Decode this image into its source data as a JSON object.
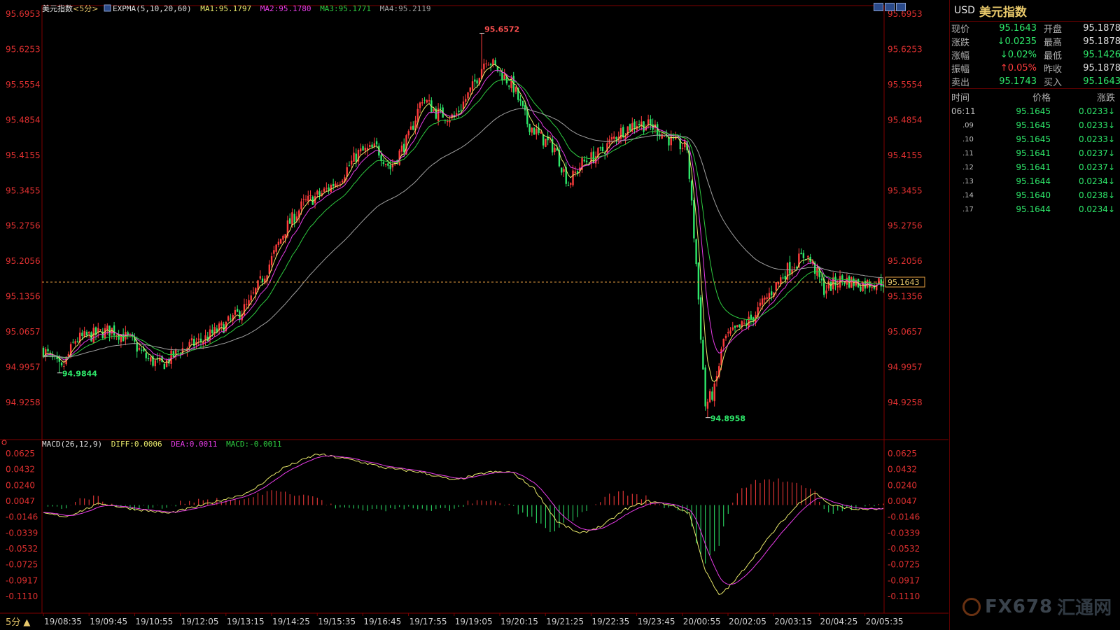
{
  "main_legend": {
    "symbol": "美元指数",
    "period": "<5分>",
    "indicator": "EXPMA(5,10,20,60)",
    "ma1": "MA1:95.1797",
    "ma2": "MA2:95.1780",
    "ma3": "MA3:95.1771",
    "ma4": "MA4:95.2119"
  },
  "macd_legend": {
    "indicator": "MACD(26,12,9)",
    "diff": "DIFF:0.0006",
    "dea": "DEA:0.0011",
    "macd": "MACD:-0.0011"
  },
  "price_axis_labels": [
    "95.6953",
    "95.6253",
    "95.5554",
    "95.4854",
    "95.4155",
    "95.3455",
    "95.2756",
    "95.2056",
    "95.1356",
    "95.0657",
    "94.9957",
    "94.9258"
  ],
  "macd_axis_labels": [
    "0.0625",
    "0.0432",
    "0.0240",
    "0.0047",
    "-0.0146",
    "-0.0339",
    "-0.0532",
    "-0.0725",
    "-0.0917",
    "-0.1110"
  ],
  "time_labels": [
    "19/08:35",
    "19/09:45",
    "19/10:55",
    "19/12:05",
    "19/13:15",
    "19/14:25",
    "19/15:35",
    "19/16:45",
    "19/17:55",
    "19/19:05",
    "19/20:15",
    "19/21:25",
    "19/22:35",
    "19/23:45",
    "20/00:55",
    "20/02:05",
    "20/03:15",
    "20/04:25",
    "20/05:35"
  ],
  "annotations": {
    "high_label": "95.6572",
    "low_label_1": "94.9844",
    "low_label_2": "94.8958",
    "current_price_tag": "95.1643"
  },
  "period_selector": "5分 ▲",
  "colors": {
    "up": "#ff3c3c",
    "down": "#2ee86a",
    "ma1": "#e8e86a",
    "ma2": "#e83ce8",
    "ma3": "#2ecc40",
    "ma4": "#a0a0a0",
    "axis_text": "#e03030",
    "grid_border": "#800000"
  },
  "panel": {
    "code": "USD",
    "name": "美元指数",
    "quotes": [
      {
        "l1": "现价",
        "v1": "95.1643",
        "c1": "#2ee86a",
        "l2": "开盘",
        "v2": "95.1878",
        "c2": "#e0e0e0"
      },
      {
        "l1": "涨跌",
        "v1": "↓0.0235",
        "c1": "#2ee86a",
        "l2": "最高",
        "v2": "95.1878",
        "c2": "#e0e0e0"
      },
      {
        "l1": "涨幅",
        "v1": "↓0.02%",
        "c1": "#2ee86a",
        "l2": "最低",
        "v2": "95.1426",
        "c2": "#2ee86a"
      },
      {
        "l1": "振幅",
        "v1": "↑0.05%",
        "c1": "#ff3c3c",
        "l2": "昨收",
        "v2": "95.1878",
        "c2": "#e0e0e0"
      },
      {
        "l1": "卖出",
        "v1": "95.1743",
        "c1": "#2ee86a",
        "l2": "买入",
        "v2": "95.1643",
        "c2": "#2ee86a"
      }
    ],
    "ticks_header": {
      "time": "时间",
      "price": "价格",
      "change": "涨跌"
    },
    "ticks": [
      {
        "t": "06:11",
        "p": "95.1645",
        "c": "0.0233↓"
      },
      {
        "t": ".09",
        "p": "95.1645",
        "c": "0.0233↓"
      },
      {
        "t": ".10",
        "p": "95.1645",
        "c": "0.0233↓"
      },
      {
        "t": ".11",
        "p": "95.1641",
        "c": "0.0237↓"
      },
      {
        "t": ".12",
        "p": "95.1641",
        "c": "0.0237↓"
      },
      {
        "t": ".13",
        "p": "95.1644",
        "c": "0.0234↓"
      },
      {
        "t": ".14",
        "p": "95.1640",
        "c": "0.0238↓"
      },
      {
        "t": ".17",
        "p": "95.1644",
        "c": "0.0234↓"
      }
    ]
  },
  "watermark": {
    "brand": "FX678",
    "cn": "汇通网"
  },
  "chart_data": {
    "type": "candlestick",
    "price_range": [
      94.8958,
      95.6953
    ],
    "current_price": 95.1643,
    "anchors": [
      [
        0,
        95.03
      ],
      [
        8,
        94.99
      ],
      [
        14,
        95.05
      ],
      [
        22,
        95.06
      ],
      [
        30,
        95.07
      ],
      [
        38,
        95.05
      ],
      [
        46,
        95.01
      ],
      [
        52,
        95.0
      ],
      [
        60,
        95.03
      ],
      [
        70,
        95.05
      ],
      [
        80,
        95.08
      ],
      [
        90,
        95.12
      ],
      [
        98,
        95.19
      ],
      [
        106,
        95.27
      ],
      [
        114,
        95.32
      ],
      [
        122,
        95.34
      ],
      [
        130,
        95.37
      ],
      [
        138,
        95.42
      ],
      [
        146,
        95.43
      ],
      [
        152,
        95.39
      ],
      [
        160,
        95.45
      ],
      [
        166,
        95.53
      ],
      [
        172,
        95.5
      ],
      [
        180,
        95.49
      ],
      [
        188,
        95.55
      ],
      [
        194,
        95.61
      ],
      [
        200,
        95.58
      ],
      [
        206,
        95.55
      ],
      [
        212,
        95.48
      ],
      [
        218,
        95.45
      ],
      [
        224,
        95.43
      ],
      [
        230,
        95.36
      ],
      [
        236,
        95.4
      ],
      [
        244,
        95.42
      ],
      [
        252,
        95.46
      ],
      [
        260,
        95.48
      ],
      [
        268,
        95.47
      ],
      [
        276,
        95.44
      ],
      [
        282,
        95.43
      ],
      [
        286,
        95.2
      ],
      [
        290,
        94.92
      ],
      [
        294,
        94.95
      ],
      [
        298,
        95.05
      ],
      [
        304,
        95.07
      ],
      [
        310,
        95.09
      ],
      [
        318,
        95.14
      ],
      [
        326,
        95.19
      ],
      [
        334,
        95.22
      ],
      [
        338,
        95.19
      ],
      [
        342,
        95.15
      ],
      [
        350,
        95.17
      ],
      [
        358,
        95.16
      ],
      [
        368,
        95.165
      ]
    ],
    "macd_range": [
      -0.111,
      0.0625
    ],
    "macd_anchors": [
      [
        0,
        -0.01
      ],
      [
        10,
        -0.014
      ],
      [
        25,
        0.002
      ],
      [
        40,
        -0.005
      ],
      [
        55,
        -0.01
      ],
      [
        70,
        0.0
      ],
      [
        90,
        0.015
      ],
      [
        105,
        0.045
      ],
      [
        120,
        0.062
      ],
      [
        135,
        0.055
      ],
      [
        150,
        0.045
      ],
      [
        165,
        0.04
      ],
      [
        180,
        0.03
      ],
      [
        195,
        0.04
      ],
      [
        205,
        0.04
      ],
      [
        215,
        0.02
      ],
      [
        225,
        -0.02
      ],
      [
        235,
        -0.035
      ],
      [
        245,
        -0.025
      ],
      [
        255,
        -0.005
      ],
      [
        265,
        0.005
      ],
      [
        275,
        0.0
      ],
      [
        283,
        -0.01
      ],
      [
        290,
        -0.08
      ],
      [
        296,
        -0.11
      ],
      [
        302,
        -0.095
      ],
      [
        312,
        -0.06
      ],
      [
        322,
        -0.025
      ],
      [
        332,
        0.005
      ],
      [
        338,
        0.015
      ],
      [
        345,
        0.0
      ],
      [
        355,
        -0.005
      ],
      [
        368,
        -0.005
      ]
    ]
  }
}
